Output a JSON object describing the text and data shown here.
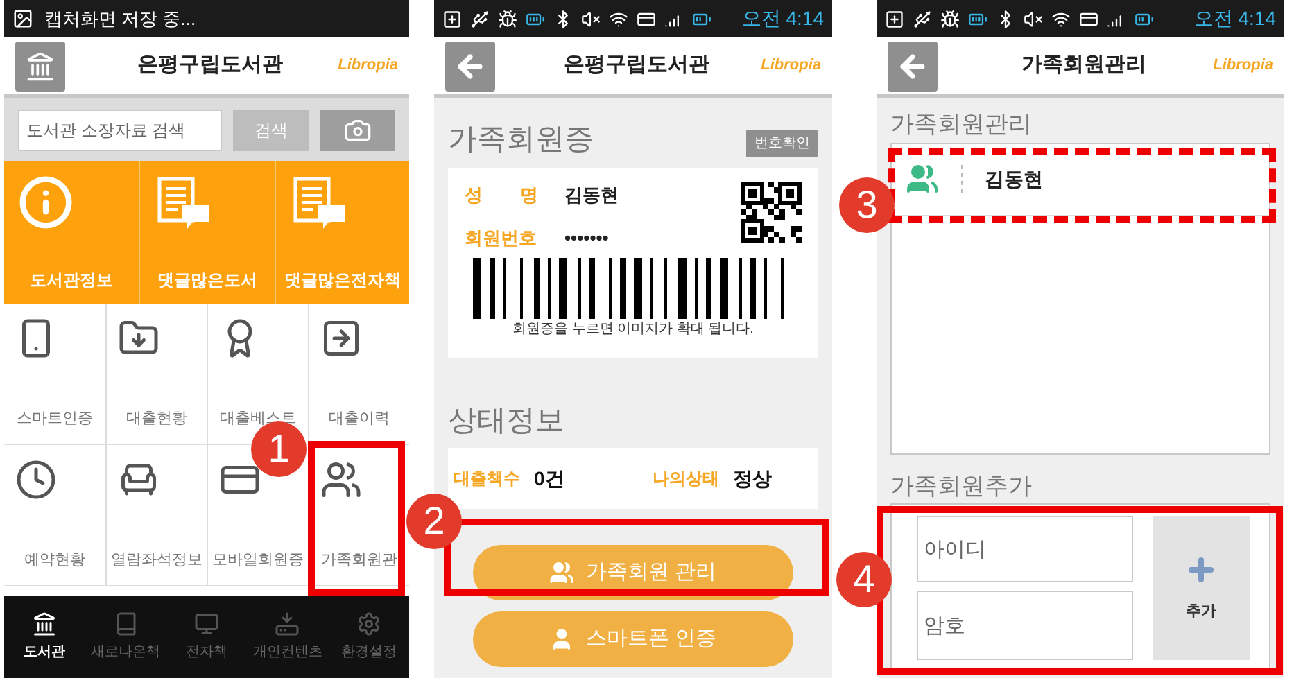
{
  "home_screen": {
    "status_text": "캡처화면 저장 중...",
    "title": "은평구립도서관",
    "logo": "Libropia",
    "search": {
      "placeholder": "도서관 소장자료 검색",
      "button": "검색"
    },
    "featured_tiles": [
      {
        "label": "도서관정보",
        "kind": "info"
      },
      {
        "label": "댓글많은도서",
        "kind": "reply"
      },
      {
        "label": "댓글많은전자책",
        "kind": "reply"
      }
    ],
    "menu_tiles": [
      {
        "label": "스마트인증",
        "kind": "phone"
      },
      {
        "label": "대출현황",
        "kind": "folder"
      },
      {
        "label": "대출베스트",
        "kind": "award"
      },
      {
        "label": "대출이력",
        "kind": "history"
      },
      {
        "label": "예약현황",
        "kind": "clock"
      },
      {
        "label": "열람좌석정보",
        "kind": "seat"
      },
      {
        "label": "모바일회원증",
        "kind": "card"
      },
      {
        "label": "가족회원관",
        "kind": "family"
      }
    ],
    "bottom_nav": [
      {
        "label": "도서관",
        "kind": "library",
        "selected": true
      },
      {
        "label": "새로나온책",
        "kind": "book",
        "selected": false
      },
      {
        "label": "전자책",
        "kind": "monitor",
        "selected": false
      },
      {
        "label": "개인컨텐츠",
        "kind": "download",
        "selected": false
      },
      {
        "label": "환경설정",
        "kind": "settings",
        "selected": false
      }
    ],
    "callout": {
      "number": "1",
      "kind": "solid"
    }
  },
  "card_screen": {
    "time": "오전 4:14",
    "title": "은평구립도서관",
    "logo": "Libropia",
    "card_heading": "가족회원증",
    "number_button": "번호확인",
    "fields": [
      {
        "label": "성 명",
        "value": "김동현"
      },
      {
        "label": "회원번호",
        "value": "•••••••"
      }
    ],
    "card_hint": "회원증을 누르면 이미지가 확대 됩니다.",
    "status_heading": "상태정보",
    "status": [
      {
        "label": "대출책수",
        "value": "0건"
      },
      {
        "label": "나의상태",
        "value": "정상"
      }
    ],
    "buttons": [
      {
        "label": "가족회원 관리",
        "kind": "family"
      },
      {
        "label": "스마트폰 인증",
        "kind": "person"
      }
    ],
    "callout": {
      "number": "2",
      "kind": "solid"
    }
  },
  "family_screen": {
    "time": "오전 4:14",
    "title": "가족회원관리",
    "logo": "Libropia",
    "list_heading": "가족회원관리",
    "members": [
      {
        "name": "김동현"
      }
    ],
    "add_heading": "가족회원추가",
    "id_field": {
      "placeholder": "아이디"
    },
    "password_field": {
      "placeholder": "암호"
    },
    "add_button": "추가",
    "callouts": [
      {
        "number": "3",
        "kind": "dashed"
      },
      {
        "number": "4",
        "kind": "solid"
      }
    ]
  }
}
